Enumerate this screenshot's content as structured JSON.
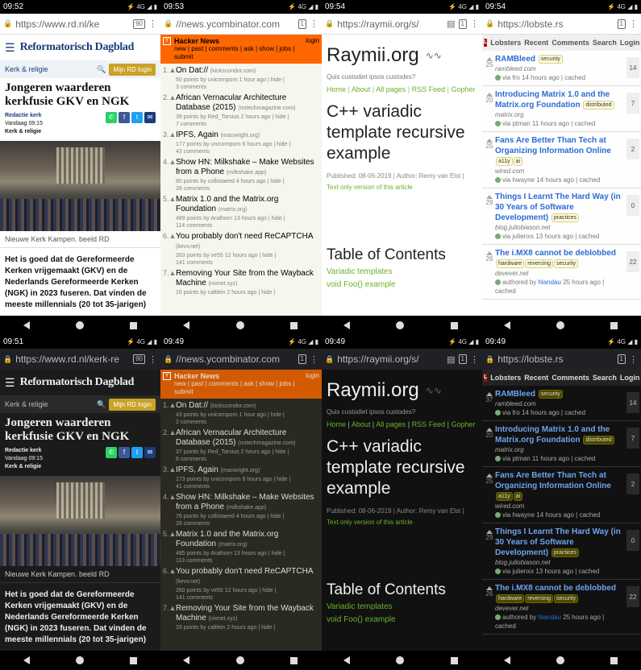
{
  "rows": [
    {
      "theme": "light",
      "rd": {
        "time": "09:52",
        "url": "https://www.rd.nl/ke",
        "brand": "Reformatorisch Dagblad",
        "section": "Kerk & religie",
        "login": "Mijn RD login",
        "title": "Jongeren waarderen kerkfusie GKV en NGK",
        "author": "Redactie kerk",
        "date": "Vandaag  09:15",
        "category": "Kerk & religie",
        "caption": "Nieuwe Kerk Kampen. beeld RD",
        "lead": "Het is goed dat de Gereformeerde Kerken vrijgemaakt (GKV) en de Nederlands Gereformeerde Kerken (NGK) in 2023 fuseren. Dat vinden de meeste millennials (20 tot 35-jarigen)"
      },
      "hn": {
        "time": "09:53",
        "url": "//news.ycombinator.com",
        "site": "Hacker News",
        "nav": "new | past | comments | ask | show | jobs | submit",
        "login": "login",
        "items": [
          {
            "rank": "1.",
            "title": "On Dat://",
            "domain": "(kickscondor.com)",
            "meta": "50 points by unicornporn 1 hour ago | hide |",
            "comments": "3 comments"
          },
          {
            "rank": "2.",
            "title": "African Vernacular Architecture Database (2015)",
            "domain": "(notechmagazine.com)",
            "meta": "39 points by Red_Tarsius 2 hours ago | hide |",
            "comments": "7 comments"
          },
          {
            "rank": "3.",
            "title": "IPFS, Again",
            "domain": "(macwright.org)",
            "meta": "177 points by unicornporn 6 hours ago | hide |",
            "comments": "43 comments"
          },
          {
            "rank": "4.",
            "title": "Show HN: Milkshake – Make Websites from a Phone",
            "domain": "(milkshake.app)",
            "meta": "80 points by collistaeed 4 hours ago | hide |",
            "comments": "28 comments"
          },
          {
            "rank": "5.",
            "title": "Matrix 1.0 and the Matrix.org Foundation",
            "domain": "(matrix.org)",
            "meta": "489 points by Arathorn 13 hours ago | hide |",
            "comments": "114 comments"
          },
          {
            "rank": "6.",
            "title": "You probably don't need ReCAPTCHA",
            "domain": "(kevv.net)",
            "meta": "263 points by ve55 12 hours ago | hide |",
            "comments": "141 comments"
          },
          {
            "rank": "7.",
            "title": "Removing Your Site from the Wayback Machine",
            "domain": "(nixnet.xyz)",
            "meta": "16 points by caltlein 2 hours ago | hide |",
            "comments": ""
          }
        ]
      },
      "ry": {
        "time": "09:54",
        "url": "https://raymii.org/s/",
        "logo": "Raymii.org",
        "tagline": "Quis custodiet ipsos custodes?",
        "nav": [
          "Home",
          "About",
          "All pages",
          "RSS Feed",
          "Gopher"
        ],
        "title": "C++ variadic template recursive example",
        "published": "Published: 08-06-2019 | Author: Remy van Elst |",
        "textonly": "Text only version of this article",
        "toc": "Table of Contents",
        "toc_items": [
          "Variadic templates",
          "void Foo() example"
        ]
      },
      "lb": {
        "time": "09:54",
        "url": "https://lobste.rs",
        "nav": [
          "Lobsters",
          "Recent",
          "Comments",
          "Search",
          "Login"
        ],
        "items": [
          {
            "score": "25",
            "title": "RAMBleed",
            "tags": [
              "security"
            ],
            "domain": "rambleed.com",
            "by": "via fro 14 hours ago | cached",
            "comments": "14"
          },
          {
            "score": "20",
            "title": "Introducing Matrix 1.0 and the Matrix.org Foundation",
            "tags": [
              "distributed"
            ],
            "domain": "matrix.org",
            "by": "via ptman 11 hours ago | cached",
            "comments": "7"
          },
          {
            "score": "25",
            "title": "Fans Are Better Than Tech at Organizing Information Online",
            "tags": [
              "a11y",
              "ai"
            ],
            "domain": "wired.com",
            "by": "via hwayne 14 hours ago | cached",
            "comments": "2"
          },
          {
            "score": "29",
            "title": "Things I Learnt The Hard Way (in 30 Years of Software Development)",
            "tags": [
              "practices"
            ],
            "domain": "blog.juliobiason.net",
            "by": "via julienxx 13 hours ago | cached",
            "comments": "0"
          },
          {
            "score": "26",
            "title": "The i.MX8 cannot be deblobbed",
            "tags": [
              "hardware",
              "reversing",
              "security"
            ],
            "domain": "devever.net",
            "by": "authored by",
            "author": "hlandau",
            "by2": "25 hours ago | cached",
            "comments": "22"
          }
        ]
      }
    },
    {
      "theme": "dark",
      "rd": {
        "time": "09:51",
        "url": "https://www.rd.nl/kerk-re",
        "brand": "Reformatorisch Dagblad",
        "section": "Kerk & religie",
        "login": "Mijn RD login",
        "title": "Jongeren waarderen kerkfusie GKV en NGK",
        "author": "Redactie kerk",
        "date": "Vandaag  09:15",
        "category": "Kerk & religie",
        "caption": "Nieuwe Kerk Kampen. beeld RD",
        "lead": "Het is goed dat de Gereformeerde Kerken vrijgemaakt (GKV) en de Nederlands Gereformeerde Kerken (NGK) in 2023 fuseren. Dat vinden de meeste millennials (20 tot 35-jarigen)"
      },
      "hn": {
        "time": "09:49",
        "url": "//news.ycombinator.com",
        "site": "Hacker News",
        "nav": "new | past | comments | ask | show | jobs | submit",
        "login": "login",
        "items": [
          {
            "rank": "1.",
            "title": "On Dat://",
            "domain": "(kickscondor.com)",
            "meta": "43 points by unicornporn 1 hour ago | hide |",
            "comments": "2 comments"
          },
          {
            "rank": "2.",
            "title": "African Vernacular Architecture Database (2015)",
            "domain": "(notechmagazine.com)",
            "meta": "37 points by Red_Tarsius 2 hours ago | hide |",
            "comments": "6 comments"
          },
          {
            "rank": "3.",
            "title": "IPFS, Again",
            "domain": "(macwright.org)",
            "meta": "173 points by unicornporn 6 hours ago | hide |",
            "comments": "41 comments"
          },
          {
            "rank": "4.",
            "title": "Show HN: Milkshake – Make Websites from a Phone",
            "domain": "(milkshake.app)",
            "meta": "76 points by collistaeed 4 hours ago | hide |",
            "comments": "28 comments"
          },
          {
            "rank": "5.",
            "title": "Matrix 1.0 and the Matrix.org Foundation",
            "domain": "(matrix.org)",
            "meta": "485 points by Arathorn 13 hours ago | hide |",
            "comments": "113 comments"
          },
          {
            "rank": "6.",
            "title": "You probably don't need ReCAPTCHA",
            "domain": "(kevv.net)",
            "meta": "260 points by ve55 12 hours ago | hide |",
            "comments": "141 comments"
          },
          {
            "rank": "7.",
            "title": "Removing Your Site from the Wayback Machine",
            "domain": "(nixnet.xyz)",
            "meta": "15 points by caltlein 2 hours ago | hide |",
            "comments": ""
          }
        ]
      },
      "ry": {
        "time": "09:49",
        "url": "https://raymii.org/s/",
        "logo": "Raymii.org",
        "tagline": "Quis custodiet ipsos custodes?",
        "nav": [
          "Home",
          "About",
          "All pages",
          "RSS Feed",
          "Gopher"
        ],
        "title": "C++ variadic template recursive example",
        "published": "Published: 08-06-2019 | Author: Remy van Elst |",
        "textonly": "Text only version of this article",
        "toc": "Table of Contents",
        "toc_items": [
          "Variadic templates",
          "void Foo() example"
        ]
      },
      "lb": {
        "time": "09:49",
        "url": "https://lobste.rs",
        "nav": [
          "Lobsters",
          "Recent",
          "Comments",
          "Search",
          "Login"
        ],
        "items": [
          {
            "score": "37",
            "title": "RAMBleed",
            "tags": [
              "security"
            ],
            "domain": "rambleed.com",
            "by": "via fro 14 hours ago | cached",
            "comments": "14"
          },
          {
            "score": "20",
            "title": "Introducing Matrix 1.0 and the Matrix.org Foundation",
            "tags": [
              "distributed"
            ],
            "domain": "matrix.org",
            "by": "via ptman 11 hours ago | cached",
            "comments": "7"
          },
          {
            "score": "25",
            "title": "Fans Are Better Than Tech at Organizing Information Online",
            "tags": [
              "a11y",
              "ai"
            ],
            "domain": "wired.com",
            "by": "via hwayne 14 hours ago | cached",
            "comments": "2"
          },
          {
            "score": "29",
            "title": "Things I Learnt The Hard Way (in 30 Years of Software Development)",
            "tags": [
              "practices"
            ],
            "domain": "blog.juliobiason.net",
            "by": "via julienxx 13 hours ago | cached",
            "comments": "0"
          },
          {
            "score": "26",
            "title": "The i.MX8 cannot be deblobbed",
            "tags": [
              "hardware",
              "reversing",
              "security"
            ],
            "domain": "devever.net",
            "by": "authored by",
            "author": "hlandau",
            "by2": "25 hours ago | cached",
            "comments": "22"
          }
        ]
      }
    }
  ],
  "status_icons": "⚡ 4G ◢ ▮",
  "tab_counts": {
    "rd_top": "90",
    "hn": "1",
    "ry": "1",
    "lb": "1"
  }
}
